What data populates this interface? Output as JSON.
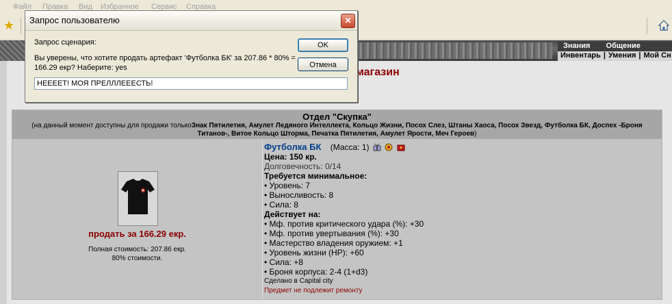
{
  "browser": {
    "menu": [
      "Файл",
      "Правка",
      "Вид",
      "Избранное",
      "Сервис",
      "Справка"
    ]
  },
  "game": {
    "top_menu": [
      "Знания",
      "Общение"
    ],
    "sub_menu": [
      "Инвентарь",
      "|",
      "Умения",
      "|",
      "Мой Сн"
    ],
    "page_heading": "магазин"
  },
  "shop": {
    "department": "Отдел \"Скупка\"",
    "available_prefix": "(на данный момент доступны для продажи только",
    "available_items": "Знак Пятилетия, Амулет Ледяного Интеллекта, Кольцо Жизни, Посох Слез, Штаны Хаоса, Посох Звезд, Футболка БК, Доспех -Броня Титанов-, Витое Кольцо Шторма, Печатка Пятилетия, Амулет Ярости, Меч Героев",
    "available_suffix": ")",
    "sell_link": "продать за 166.29 екр.",
    "full_cost": "Полная стоимость: 207.86 екр.",
    "percent_cost": "80% стоимости.",
    "item": {
      "name": "Футболка БК",
      "mass": "(Масса: 1)",
      "price": "Цена: 150 кр.",
      "durability": "Долговечность: 0/14",
      "requirements_title": "Требуется минимальное:",
      "requirements": [
        "• Уровень: 7",
        "• Выносливость: 8",
        "• Сила: 8"
      ],
      "effects_title": "Действует на:",
      "effects": [
        "• Мф. против критического удара (%): +30",
        "• Мф. против увертывания (%): +30",
        "• Мастерство владения оружием: +1",
        "• Уровень жизни (HP): +60",
        "• Сила: +8",
        "• Броня корпуса: 2-4 (1+d3)"
      ],
      "made_in": "Сделано в Capital city",
      "repair_note": "Предмет не подлежит ремонту"
    }
  },
  "dialog": {
    "title": "Запрос пользователю",
    "label": "Запрос сценария:",
    "message": "Вы уверены, что хотите продать артефакт 'Футболка БК' за 207.86 * 80% = 166.29 екр? Наберите: yes",
    "input_value": "НЕЕЕЕТ! МОЯ ПРЕЛЛЛЕЕЕСТЬ!",
    "ok_label": "OK",
    "cancel_label": "Отмена",
    "close_glyph": "✕"
  },
  "colors": {
    "accent_red": "#8b0000",
    "item_blue": "#003f8a",
    "shop_bg": "#c4c4c4",
    "shop_header_bg": "#a6a6a6"
  }
}
